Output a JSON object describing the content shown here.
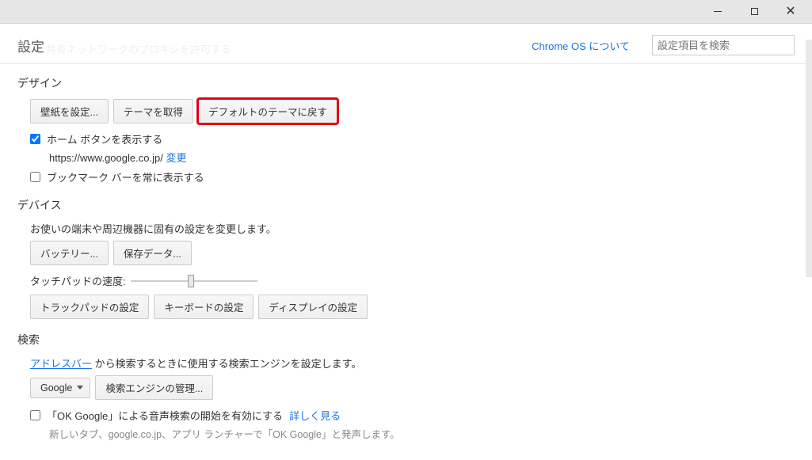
{
  "header": {
    "title": "設定",
    "faded_text": "共有ネットワークのプロキシを許可する",
    "about_link": "Chrome OS について",
    "search_placeholder": "設定項目を検索"
  },
  "design": {
    "title": "デザイン",
    "set_wallpaper": "壁紙を設定...",
    "get_theme": "テーマを取得",
    "reset_theme": "デフォルトのテーマに戻す",
    "show_home_checked": true,
    "show_home_label": "ホーム ボタンを表示する",
    "home_url": "https://www.google.co.jp/",
    "change_link": "変更",
    "show_bookmark_bar_checked": false,
    "show_bookmark_bar_label": "ブックマーク バーを常に表示する"
  },
  "device": {
    "title": "デバイス",
    "desc": "お使いの端末や周辺機器に固有の設定を変更します。",
    "battery": "バッテリー...",
    "storage": "保存データ...",
    "touchpad_speed_label": "タッチパッドの速度:",
    "trackpad_settings": "トラックパッドの設定",
    "keyboard_settings": "キーボードの設定",
    "display_settings": "ディスプレイの設定"
  },
  "search": {
    "title": "検索",
    "address_bar_link": "アドレスバー",
    "desc_rest": " から検索するときに使用する検索エンジンを設定します。",
    "engine_selected": "Google",
    "manage_engines": "検索エンジンの管理...",
    "ok_google_checked": false,
    "ok_google_label": "「OK Google」による音声検索の開始を有効にする",
    "learn_more": "詳しく見る",
    "ok_google_sub": "新しいタブ、google.co.jp、アプリ ランチャーで「OK Google」と発声します。"
  }
}
